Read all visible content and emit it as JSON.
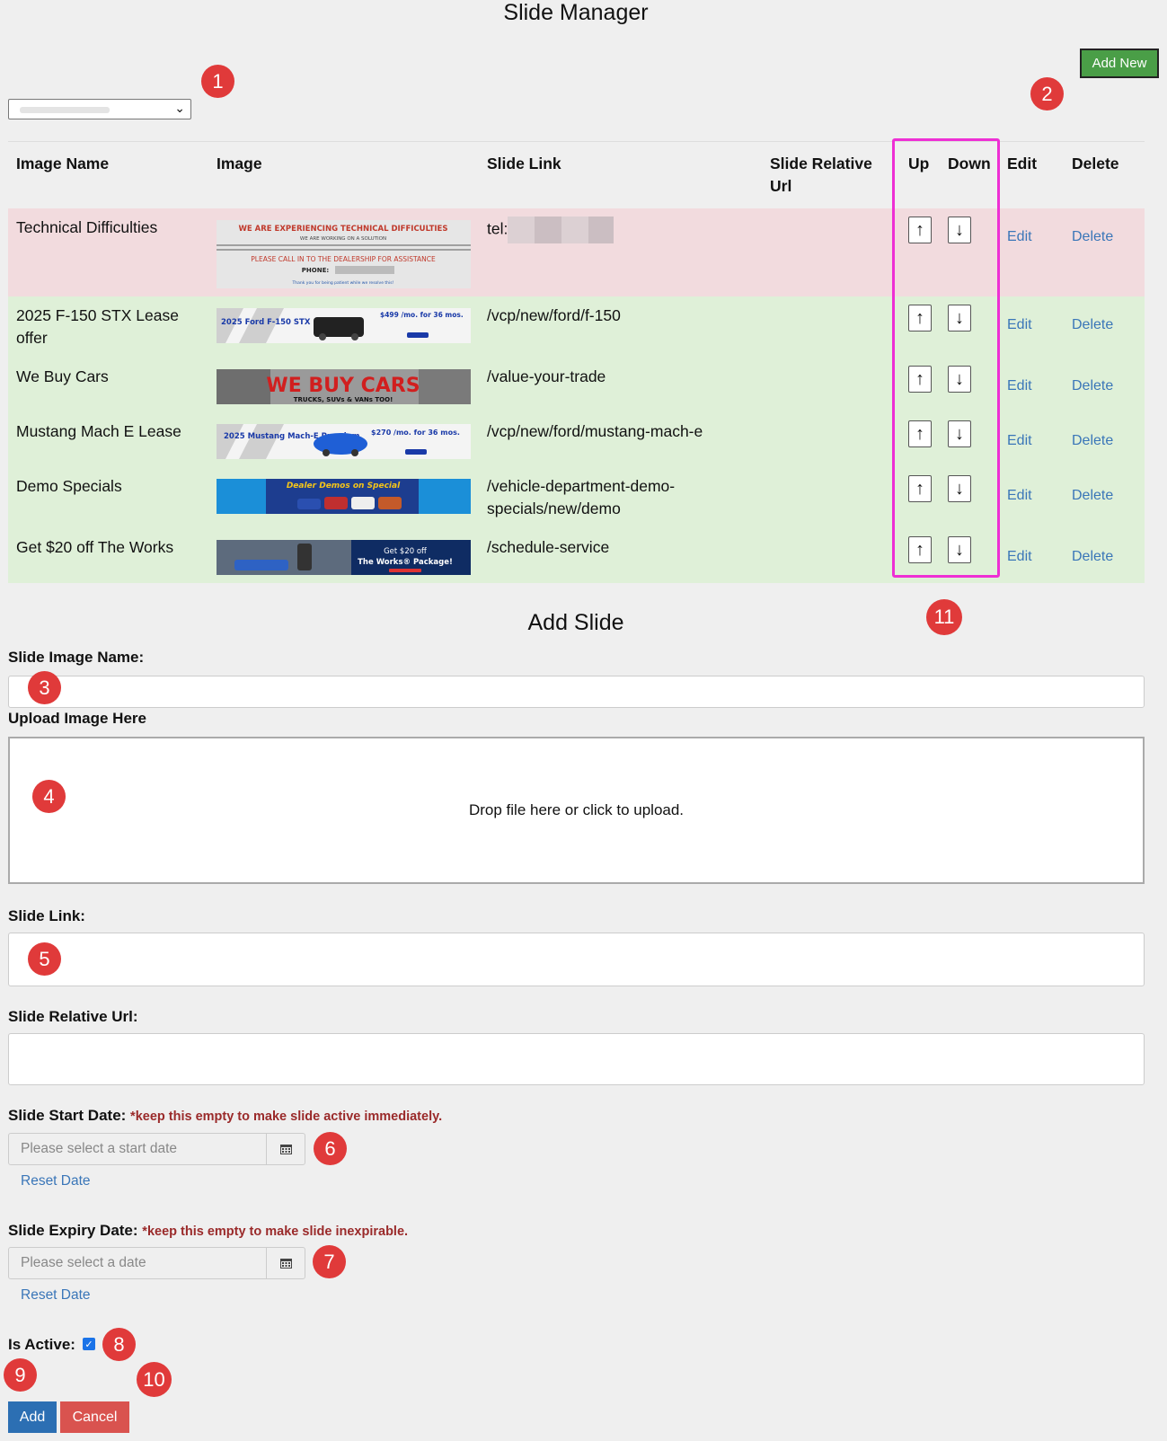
{
  "page": {
    "title": "Slide Manager"
  },
  "toolbar": {
    "add_new_label": "Add New"
  },
  "table": {
    "columns": [
      "Image Name",
      "Image",
      "Slide Link",
      "Slide Relative Url",
      "Up",
      "Down",
      "Edit",
      "Delete"
    ],
    "rows": [
      {
        "name": "Technical Difficulties",
        "link": "tel:",
        "relative_url": "",
        "status": "danger",
        "edit": "Edit",
        "delete": "Delete",
        "up": "↑",
        "down": "↓"
      },
      {
        "name": "2025 F-150 STX Lease offer",
        "link": "/vcp/new/ford/f-150",
        "relative_url": "",
        "status": "success",
        "edit": "Edit",
        "delete": "Delete",
        "up": "↑",
        "down": "↓"
      },
      {
        "name": "We Buy Cars",
        "link": "/value-your-trade",
        "relative_url": "",
        "status": "success",
        "edit": "Edit",
        "delete": "Delete",
        "up": "↑",
        "down": "↓"
      },
      {
        "name": "Mustang Mach E Lease",
        "link": "/vcp/new/ford/mustang-mach-e",
        "relative_url": "",
        "status": "success",
        "edit": "Edit",
        "delete": "Delete",
        "up": "↑",
        "down": "↓"
      },
      {
        "name": "Demo Specials",
        "link": "/vehicle-department-demo-specials/new/demo",
        "relative_url": "",
        "status": "success",
        "edit": "Edit",
        "delete": "Delete",
        "up": "↑",
        "down": "↓"
      },
      {
        "name": "Get $20 off The Works",
        "link": "/schedule-service",
        "relative_url": "",
        "status": "success",
        "edit": "Edit",
        "delete": "Delete",
        "up": "↑",
        "down": "↓"
      }
    ]
  },
  "banners": {
    "tech": {
      "line1": "WE ARE EXPERIENCING TECHNICAL DIFFICULTIES",
      "line2": "WE ARE WORKING ON A SOLUTION",
      "line3": "PLEASE CALL IN TO THE DEALERSHIP FOR ASSISTANCE",
      "line4": "PHONE:",
      "line5": "Thank you for being patient while we resolve this!"
    },
    "f150": {
      "title": "2025 Ford F-150 STX",
      "price": "$499 /mo. for 36 mos."
    },
    "webuy": {
      "title": "WE BUY CARS",
      "sub": "TRUCKS, SUVs & VANs TOO!"
    },
    "mach": {
      "title": "2025 Mustang Mach-E Premium",
      "price": "$270 /mo. for 36 mos."
    },
    "demo": {
      "title": "Dealer Demos on Special"
    },
    "works": {
      "line1": "Get $20 off",
      "line2": "The Works® Package!"
    }
  },
  "form": {
    "title": "Add Slide",
    "image_name_label": "Slide Image Name:",
    "upload_label": "Upload Image Here",
    "dropzone_text": "Drop file here or click to upload.",
    "slide_link_label": "Slide Link:",
    "relative_url_label": "Slide Relative Url:",
    "start_date_label": "Slide Start Date:",
    "start_date_note": "*keep this empty to make slide active immediately.",
    "start_date_placeholder": "Please select a start date",
    "expiry_date_label": "Slide Expiry Date:",
    "expiry_date_note": "*keep this empty to make slide inexpirable.",
    "expiry_date_placeholder": "Please select a date",
    "reset_label": "Reset Date",
    "is_active_label": "Is Active:",
    "is_active_checked": true,
    "add_label": "Add",
    "cancel_label": "Cancel"
  },
  "callouts": [
    "1",
    "2",
    "3",
    "4",
    "5",
    "6",
    "7",
    "8",
    "9",
    "10",
    "11"
  ],
  "colors": {
    "highlight": "#ee2fd4",
    "callout": "#e03a3a",
    "add_new": "#4a9e47",
    "primary": "#2c6fb3",
    "danger": "#d9534f"
  }
}
